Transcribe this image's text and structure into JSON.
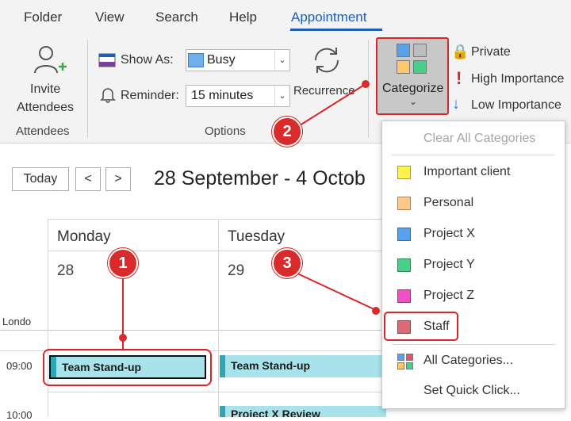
{
  "ribbon_tabs": [
    "Folder",
    "View",
    "Search",
    "Help",
    "Appointment"
  ],
  "attendees_group": {
    "button_label_line1": "Invite",
    "button_label_line2": "Attendees",
    "group_label": "Attendees"
  },
  "options_group": {
    "show_as_label": "Show As:",
    "show_as_value": "Busy",
    "reminder_label": "Reminder:",
    "reminder_value": "15 minutes",
    "recurrence_label": "Recurrence",
    "group_label": "Options"
  },
  "tags_group": {
    "categorize_label": "Categorize",
    "private_label": "Private",
    "high_importance_label": "High Importance",
    "low_importance_label": "Low Importance"
  },
  "calendar": {
    "today_label": "Today",
    "prev_label": "<",
    "next_label": ">",
    "date_range": "28 September - 4 Octob",
    "timezone_label": "Londo",
    "days": [
      {
        "name": "Monday",
        "date": "28"
      },
      {
        "name": "Tuesday",
        "date": "29"
      }
    ],
    "times": [
      "09:00",
      "10:00"
    ],
    "events": [
      {
        "title": "Team Stand-up",
        "day": "Monday",
        "time": "09:00"
      },
      {
        "title": "Team Stand-up",
        "day": "Tuesday",
        "time": "09:00"
      },
      {
        "title": "Project X Review",
        "day": "Tuesday",
        "time": "10:00"
      }
    ]
  },
  "category_menu": {
    "clear_all": "Clear All Categories",
    "categories": [
      {
        "name": "Important client",
        "color": "#fff24f"
      },
      {
        "name": "Personal",
        "color": "#ffc98a"
      },
      {
        "name": "Project X",
        "color": "#5aa0ea"
      },
      {
        "name": "Project Y",
        "color": "#49cf8a"
      },
      {
        "name": "Project Z",
        "color": "#f04fc7"
      },
      {
        "name": "Staff",
        "color": "#d96a78"
      }
    ],
    "all_categories": "All Categories...",
    "set_quick_click": "Set Quick Click..."
  },
  "annotations": {
    "marker_1": "1",
    "marker_2": "2",
    "marker_3": "3"
  },
  "colors": {
    "accent": "#1e5fb4",
    "highlight_red": "#d9252a",
    "event_fill": "#a8e2ea"
  }
}
